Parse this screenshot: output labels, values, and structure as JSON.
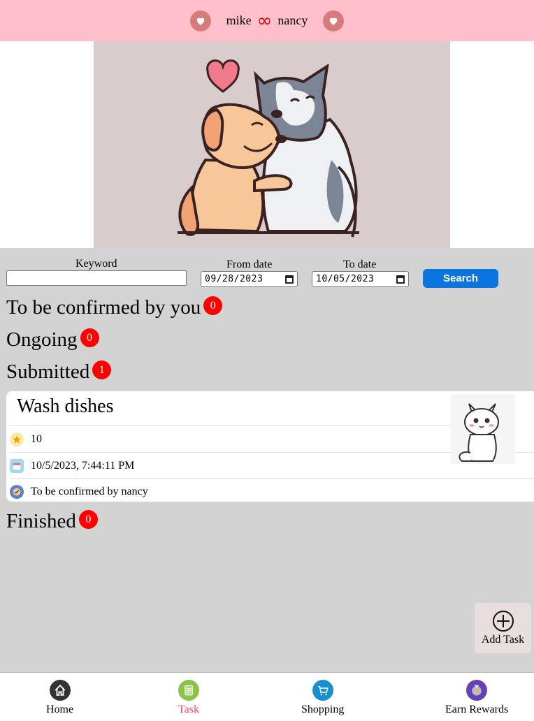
{
  "header": {
    "user1": "mike",
    "separator": "∞",
    "user2": "nancy"
  },
  "filters": {
    "keyword_label": "Keyword",
    "keyword_value": "",
    "from_label": "From date",
    "from_value": "09/28/2023",
    "to_label": "To date",
    "to_value": "10/05/2023",
    "search_label": "Search"
  },
  "sections": [
    {
      "title": "To be confirmed by you",
      "count": "0"
    },
    {
      "title": "Ongoing",
      "count": "0"
    },
    {
      "title": "Submitted",
      "count": "1"
    },
    {
      "title": "Finished",
      "count": "0"
    }
  ],
  "task": {
    "title": "Wash dishes",
    "points": "10",
    "date": "10/5/2023, 7:44:11 PM",
    "status": "To be confirmed by nancy"
  },
  "add_task": {
    "label": "Add Task"
  },
  "nav": {
    "home": "Home",
    "task": "Task",
    "shopping": "Shopping",
    "rewards": "Earn Rewards",
    "active_color": "#e84a7a"
  }
}
